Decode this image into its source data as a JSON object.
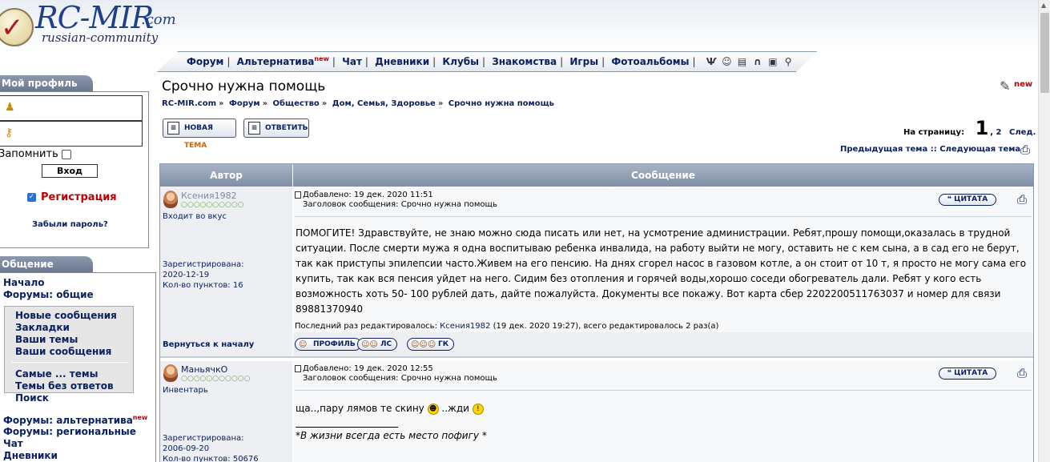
{
  "header": {
    "logo_title": "RC-MIR",
    "logo_com": ".com",
    "logo_sub": "russian-community"
  },
  "nav": {
    "items": [
      "Форум",
      "Альтернатива",
      "Чат",
      "Дневники",
      "Клубы",
      "Знакомства",
      "Игры",
      "Фотоальбомы"
    ],
    "new_badge": "new",
    "icons": [
      "members-icon",
      "users-icon",
      "calendar-icon",
      "headphones-icon",
      "tv-icon",
      "search-icon"
    ]
  },
  "sidebar": {
    "profile_title": "Мой профиль",
    "remember_label": "Запомнить",
    "login_label": "Вход",
    "register_label": "Регистрация",
    "forgot_label": "Забыли пароль?",
    "community_title": "Общение",
    "links_top": [
      "Начало",
      "Форумы: общие"
    ],
    "inner_links_a": [
      "Новые сообщения",
      "Закладки",
      "Ваши темы",
      "Ваши сообщения"
    ],
    "inner_links_b": [
      "Самые ... темы",
      "Темы без ответов",
      "Поиск"
    ],
    "links_bottom": [
      "Форумы: альтернатива",
      "Форумы: региональные",
      "Чат",
      "Дневники"
    ],
    "new_badge": "new"
  },
  "main": {
    "title": "Срочно нужна помощь",
    "new_label": "new",
    "breadcrumb": [
      "RC-MIR.com",
      "Форум",
      "Общество",
      "Дом, Семья, Здоровье",
      "Срочно нужна помощь"
    ],
    "new_topic_a": "НОВАЯ ",
    "new_topic_b": "ТЕМА",
    "reply_label": "ОТВЕТИТЬ",
    "pages_label": "На страницу:",
    "current_page": "1",
    "other_page": "2",
    "next_label": "След.",
    "prev_topic": "Предыдущая тема",
    "next_topic": "Следующая тема",
    "col_author": "Автор",
    "col_message": "Сообщение",
    "back_to_top": "Вернуться к началу",
    "profile_btn": "ПРОФИЛЬ",
    "pm_btn": "ЛС",
    "gk_btn": "ГК"
  },
  "posts": [
    {
      "author": "Ксения1982",
      "rank_dots": "○○○○○○○○○○",
      "rank": "Входит во вкус",
      "reg_label": "Зарегистрирована:",
      "reg_date": "2020-12-19",
      "points": "Кол-во пунктов: 16",
      "posted": "Добавлено: 19 дек. 2020 11:51",
      "subject": "Заголовок сообщения: Срочно нужна помощь",
      "quote": "ЦИТАТА",
      "body": "ПОМОГИТЕ! Здравствуйте, не знаю можно сюда писать или нет, на усмотрение администрации. Ребят,прошу помощи,оказалась в трудной ситуации. После смерти мужа я одна воспитываю ребенка инвалида, на работу выйти не могу, оставить не с кем сына, а в сад его не берут, так как приступы эпилепсии часто.Живем на его пенсию. На днях сгорел насос в газовом котле, а он стоит от 10 т, я просто не могу сама его купить, так как вся пенсия уйдет на него. Сидим без отопления и горячей воды,хорошо соседи обогреватель дали. Ребят у кого есть возможность хоть 50- 100 рублей дать, дайте пожалуйста. Документы все покажу. Вот карта сбер 2202200511763037 и номер для связи 89881370940",
      "edited_prefix": "Последний раз редактировалось: ",
      "edited_name": "Ксения1982",
      "edited_suffix": " (19 дек. 2020 19:27), всего редактировалось 2 раз(а)"
    },
    {
      "author": "МаньячкО",
      "rank_dots": "○○○○○○○○○○○",
      "rank": "Инвентарь",
      "reg_label": "Зарегистрирована:",
      "reg_date": "2006-09-20",
      "points": "Кол-во пунктов: 50676",
      "posted": "Добавлено: 19 дек. 2020 12:55",
      "subject": "Заголовок сообщения: Срочно нужна помощь",
      "quote": "ЦИТАТА",
      "body_a": "ща..,пару лямов те скину ",
      "body_b": " ..жди ",
      "signature": "*В жизни всегда есть место пофигу *"
    }
  ]
}
